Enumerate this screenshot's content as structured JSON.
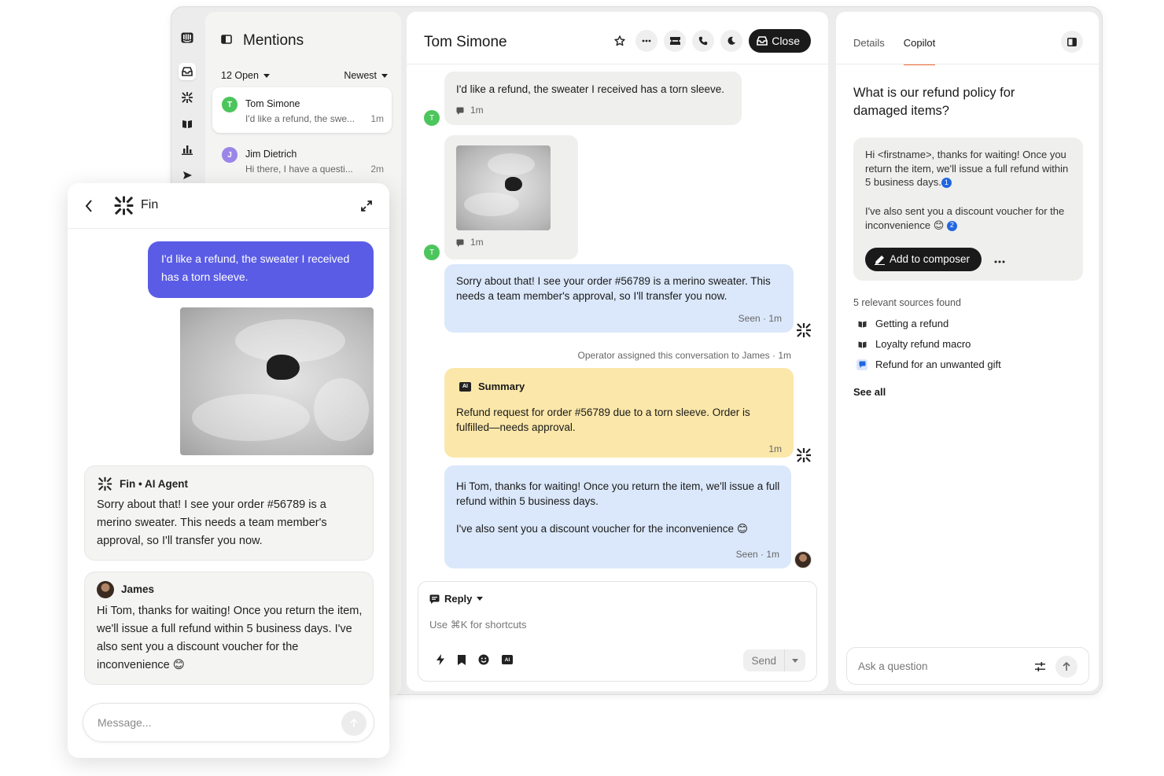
{
  "sidebar": {
    "icons": [
      "inbox-logo-icon",
      "inbox-icon",
      "fin-icon",
      "knowledge-icon",
      "reports-icon",
      "outbound-icon"
    ]
  },
  "mentions": {
    "title": "Mentions",
    "filter_open": "12 Open",
    "sort": "Newest",
    "items": [
      {
        "avatar": "T",
        "name": "Tom Simone",
        "snippet": "I'd like a refund, the swe...",
        "time": "1m",
        "color": "#4cc55c"
      },
      {
        "avatar": "J",
        "name": "Jim Dietrich",
        "snippet": "Hi there, I have a questi...",
        "time": "2m",
        "color": "#9b86e8"
      }
    ]
  },
  "conversation": {
    "title": "Tom Simone",
    "close_label": "Close",
    "messages": {
      "m1_text": "I'd like a refund, the sweater I received has a torn sleeve.",
      "m1_time": "1m",
      "m2_time": "1m",
      "m3_text": "Sorry about that! I see your order #56789 is a merino sweater. This needs a team member's approval, so I'll transfer you now.",
      "m3_meta": "Seen · 1m",
      "event": "Operator assigned this conversation to James · 1m",
      "summary_title": "Summary",
      "summary_badge": "AI",
      "summary_text": "Refund request for order #56789 due to a torn sleeve. Order is fulfilled—needs approval.",
      "summary_time": "1m",
      "m5_text1": "Hi Tom, thanks for waiting! Once you return the item, we'll issue a full refund within 5 business days.",
      "m5_text2": "I've also sent you a discount voucher for the inconvenience",
      "m5_emoji": "😊",
      "m5_meta": "Seen · 1m"
    },
    "avatar_letter": "T",
    "composer": {
      "mode": "Reply",
      "placeholder": "Use ⌘K for shortcuts",
      "send_label": "Send",
      "ai_badge": "AI"
    }
  },
  "copilot": {
    "tabs": [
      "Details",
      "Copilot"
    ],
    "active_tab": "Copilot",
    "question": "What is our refund policy for damaged items?",
    "answer_p1": "Hi <firstname>, thanks for waiting! Once you return the item, we'll issue a full refund within 5 business days.",
    "answer_p2": "I've also sent you a discount voucher for the inconvenience",
    "answer_emoji": "😊",
    "cite1": "1",
    "cite2": "2",
    "add_label": "Add to composer",
    "sources_title": "5 relevant sources found",
    "sources": [
      "Getting a refund",
      "Loyalty refund macro",
      "Refund for an unwanted gift"
    ],
    "see_all": "See all",
    "ask_placeholder": "Ask a question"
  },
  "fin_widget": {
    "title": "Fin",
    "user_message": "I'd like a refund, the sweater I received has a torn sleeve.",
    "agent_name": "Fin • AI Agent",
    "agent_message": "Sorry about that! I see your order #56789 is a merino sweater. This needs a team member's approval, so I'll transfer you now.",
    "human_name": "James",
    "human_message": "Hi Tom, thanks for waiting! Once you return the item, we'll issue a full refund within 5 business days. I've also sent you a discount voucher for the inconvenience",
    "human_emoji": "😊",
    "input_placeholder": "Message..."
  },
  "colors": {
    "accent_purple": "#5a5ce6",
    "tab_underline": "#f06a35",
    "bubble_blue": "#dbe8fb",
    "summary_yellow": "#fbe7a9",
    "badge_blue": "#2166e0"
  }
}
